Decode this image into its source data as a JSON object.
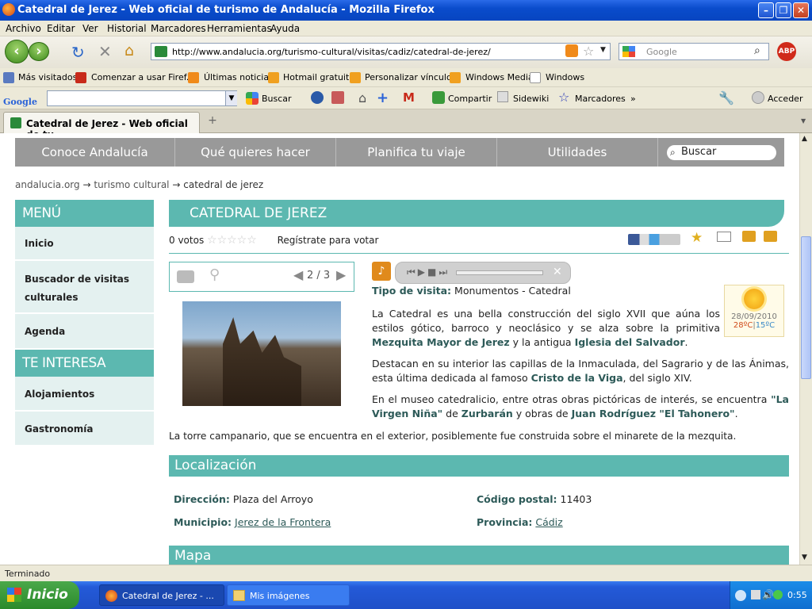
{
  "window": {
    "title": "Catedral de Jerez - Web oficial de turismo de Andalucía - Mozilla Firefox"
  },
  "menu": [
    "Archivo",
    "Editar",
    "Ver",
    "Historial",
    "Marcadores",
    "Herramientas",
    "Ayuda"
  ],
  "url": "http://www.andalucia.org/turismo-cultural/visitas/cadiz/catedral-de-jerez/",
  "search_engine": {
    "placeholder": "Google"
  },
  "bookmarks": [
    "Más visitados",
    "Comenzar a usar Firef...",
    "Últimas noticias",
    "Hotmail gratuito",
    "Personalizar vínculos",
    "Windows Media",
    "Windows"
  ],
  "google_toolbar": {
    "logo": "Google",
    "buscar": "Buscar",
    "compartir": "Compartir",
    "sidewiki": "Sidewiki",
    "marcadores": "Marcadores",
    "more": "»",
    "acceder": "Acceder"
  },
  "tab": {
    "label": "Catedral de Jerez - Web oficial de tu..."
  },
  "site": {
    "nav": [
      "Conoce Andalucía",
      "Qué quieres hacer",
      "Planifica tu viaje",
      "Utilidades"
    ],
    "search_placeholder": "Buscar",
    "breadcrumb": {
      "home": "andalucia.org",
      "sep": "→",
      "cat": "turismo cultural",
      "current": "catedral de jerez"
    },
    "sidebar": {
      "menu_title": "MENÚ",
      "items": [
        "Inicio",
        "Buscador de visitas culturales",
        "Agenda"
      ],
      "interest_title": "TE INTERESA",
      "interest_items": [
        "Alojamientos",
        "Gastronomía"
      ]
    },
    "page_title": "CATEDRAL DE JEREZ",
    "votes": "0 votos",
    "register_vote": "Regístrate para votar",
    "gallery_counter": "2 / 3",
    "tipo_label": "Tipo de visita:",
    "tipo_value": "Monumentos - Catedral",
    "weather": {
      "date": "28/09/2010",
      "max": "28ºC",
      "min": "15ºC"
    },
    "p1": {
      "a": "La Catedral es una bella construcción del siglo XVII que aúna los estilos gótico, barroco y neoclásico y se alza sobre la primitiva ",
      "b1": "Mezquita Mayor de Jerez",
      "c": " y la antigua ",
      "b2": "Iglesia del Salvador",
      "d": "."
    },
    "p2": {
      "a": "Destacan en su interior las capillas de la Inmaculada, del Sagrario y de las Ánimas, esta última dedicada al famoso ",
      "b1": "Cristo de la Viga",
      "c": ", del siglo XIV."
    },
    "p3": {
      "a": "En el museo catedralicio, entre otras obras pictóricas de interés, se encuentra ",
      "b1": "\"La Virgen Niña\"",
      "c": " de ",
      "b2": "Zurbarán",
      "d": " y obras de ",
      "b3": "Juan Rodríguez \"El Tahonero\"",
      "e": "."
    },
    "p4": "La torre campanario, que se encuentra en el exterior, posiblemente fue construida sobre el minarete de la mezquita.",
    "localizacion": {
      "title": "Localización",
      "direccion_label": "Dirección:",
      "direccion": "Plaza del Arroyo",
      "cp_label": "Código postal:",
      "cp": "11403",
      "municipio_label": "Municipio:",
      "municipio": "Jerez de la Frontera",
      "provincia_label": "Provincia:",
      "provincia": "Cádiz"
    },
    "mapa_title": "Mapa"
  },
  "status": "Terminado",
  "taskbar": {
    "start": "Inicio",
    "task1": "Catedral de Jerez - ...",
    "task2": "Mis imágenes",
    "clock": "0:55"
  },
  "colors": {
    "teal": "#5cb8b0",
    "nav_gray": "#999999",
    "xp_blue": "#245ad8"
  }
}
